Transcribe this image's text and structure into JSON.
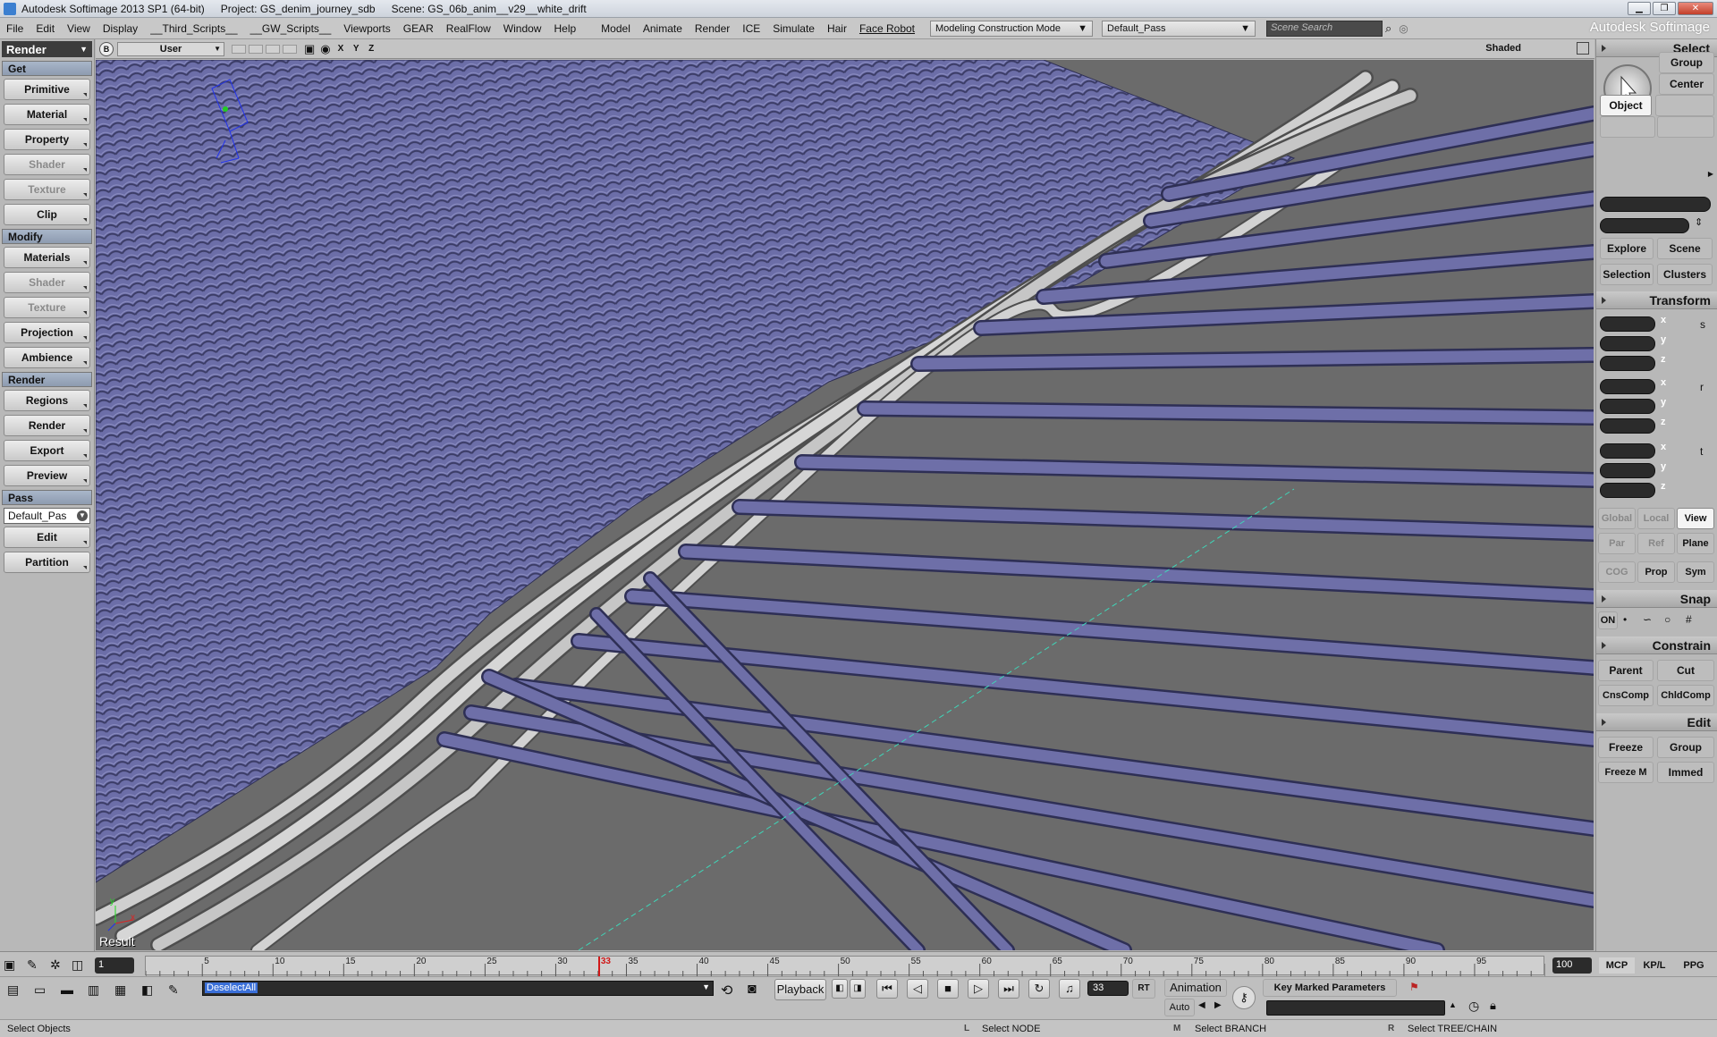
{
  "titlebar": {
    "app": "Autodesk Softimage 2013 SP1 (64-bit)",
    "project": "Project: GS_denim_journey_sdb",
    "scene": "Scene: GS_06b_anim__v29__white_drift"
  },
  "menu": [
    "File",
    "Edit",
    "View",
    "Display",
    "__Third_Scripts__",
    "__GW_Scripts__",
    "Viewports",
    "GEAR",
    "RealFlow",
    "Window",
    "Help"
  ],
  "modules": [
    "Model",
    "Animate",
    "Render",
    "ICE",
    "Simulate",
    "Hair",
    "Face Robot"
  ],
  "construction_mode": "Modeling Construction Mode",
  "pass_dropdown": "Default_Pass",
  "search_placeholder": "Scene Search",
  "brand": "Autodesk Softimage",
  "left": {
    "mode": "Render",
    "get_header": "Get",
    "get_buttons": [
      {
        "label": "Primitive",
        "enabled": true
      },
      {
        "label": "Material",
        "enabled": true
      },
      {
        "label": "Property",
        "enabled": true
      },
      {
        "label": "Shader",
        "enabled": false
      },
      {
        "label": "Texture",
        "enabled": false
      },
      {
        "label": "Clip",
        "enabled": true
      }
    ],
    "modify_header": "Modify",
    "modify_buttons": [
      {
        "label": "Materials",
        "enabled": true
      },
      {
        "label": "Shader",
        "enabled": false
      },
      {
        "label": "Texture",
        "enabled": false
      },
      {
        "label": "Projection",
        "enabled": true
      },
      {
        "label": "Ambience",
        "enabled": true
      }
    ],
    "render_header": "Render",
    "render_buttons": [
      {
        "label": "Regions",
        "enabled": true
      },
      {
        "label": "Render",
        "enabled": true
      },
      {
        "label": "Export",
        "enabled": true
      },
      {
        "label": "Preview",
        "enabled": true
      }
    ],
    "pass_header": "Pass",
    "pass_value": "Default_Pas",
    "pass_buttons": [
      {
        "label": "Edit",
        "enabled": true
      },
      {
        "label": "Partition",
        "enabled": true
      }
    ]
  },
  "viewport": {
    "letter": "B",
    "camera": "User",
    "axes": "X Y Z",
    "shading": "Shaded",
    "result_label": "Result"
  },
  "right": {
    "select_header": "Select",
    "group": "Group",
    "center": "Center",
    "object": "Object",
    "explore": "Explore",
    "scene": "Scene",
    "selection": "Selection",
    "clusters": "Clusters",
    "transform_header": "Transform",
    "axis_x": "x",
    "axis_y": "y",
    "axis_z": "z",
    "global": "Global",
    "local": "Local",
    "view": "View",
    "par": "Par",
    "ref": "Ref",
    "plane": "Plane",
    "cog": "COG",
    "prop": "Prop",
    "sym": "Sym",
    "snap_header": "Snap",
    "on": "ON",
    "constrain_header": "Constrain",
    "parent": "Parent",
    "cut": "Cut",
    "cnscomp": "CnsComp",
    "chldcomp": "ChldComp",
    "edit_header": "Edit",
    "freeze": "Freeze",
    "edit_group": "Group",
    "freeze_m": "Freeze M",
    "immed": "Immed",
    "tabs": [
      "MCP",
      "KP/L",
      "PPG"
    ]
  },
  "timeline": {
    "start": "1",
    "end": "100",
    "current": "33",
    "ticks": [
      "5",
      "10",
      "15",
      "20",
      "25",
      "30",
      "35",
      "40",
      "45",
      "50",
      "55",
      "60",
      "65",
      "70",
      "75",
      "80",
      "85",
      "90",
      "95"
    ],
    "current_marker": "33"
  },
  "bottom": {
    "command": "DeselectAll",
    "playback": "Playback",
    "frame": "33",
    "rt": "RT",
    "animation": "Animation",
    "auto": "Auto",
    "key_marked": "Key Marked Parameters"
  },
  "status": {
    "message": "Select Objects",
    "l_key": "L",
    "l_text": "Select NODE",
    "m_key": "M",
    "m_text": "Select BRANCH",
    "r_key": "R",
    "r_text": "Select TREE/CHAIN"
  },
  "colors": {
    "thread_blue": "#6e6fa8",
    "thread_white": "#d0d0d0",
    "viewport_bg": "#6b6b6b",
    "section_header": "#9aa7bb",
    "timeline_marker": "#d01818"
  }
}
